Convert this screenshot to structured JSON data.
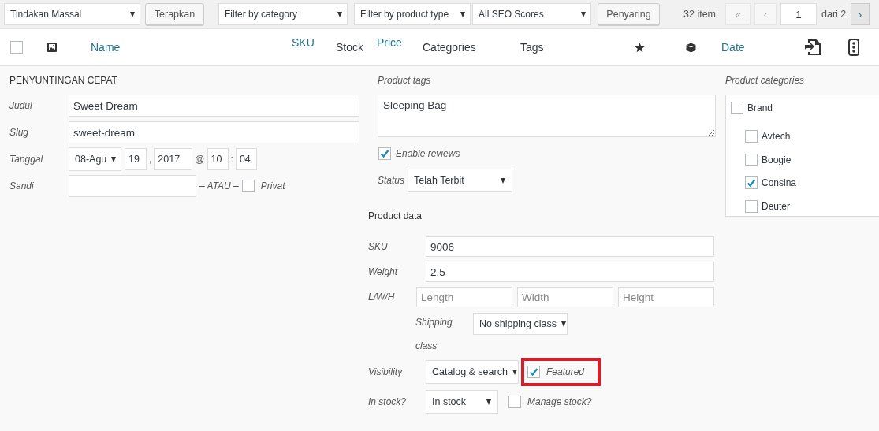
{
  "toolbar": {
    "bulk_action": "Tindakan Massal",
    "apply_button": "Terapkan",
    "filters": [
      {
        "value": "Filter by category"
      },
      {
        "value": "Filter by product type"
      },
      {
        "value": "All SEO Scores"
      }
    ],
    "filter_button": "Penyaring",
    "item_count": "32 item",
    "pagination": {
      "first": "«",
      "previous": "‹",
      "page": "1",
      "of": "dari 2",
      "next": "›"
    }
  },
  "table": {
    "columns": [
      {
        "kind": "checkbox",
        "checked": false
      },
      {
        "kind": "image"
      },
      {
        "kind": "link",
        "label": "Name"
      },
      {
        "kind": "sortable",
        "label": "SKU"
      },
      {
        "kind": "plain",
        "label": "Stock"
      },
      {
        "kind": "sortable",
        "label": "Price"
      },
      {
        "kind": "plain",
        "label": "Categories"
      },
      {
        "kind": "plain",
        "label": "Tags"
      },
      {
        "kind": "star"
      },
      {
        "kind": "cube"
      },
      {
        "kind": "link",
        "label": "Date"
      },
      {
        "kind": "import"
      },
      {
        "kind": "lights"
      }
    ]
  },
  "quick_edit": {
    "heading": "PENYUNTINGAN CEPAT",
    "fields": [
      {
        "label": "Judul",
        "value": "Sweet Dream"
      },
      {
        "label": "Slug",
        "value": "sweet-dream"
      }
    ],
    "date": {
      "label": "Tanggal",
      "month": "08-Agu",
      "day": "19",
      "comma": ",",
      "year": "2017",
      "at": "@",
      "hour": "10",
      "colon": ":",
      "minute": "04"
    },
    "password": {
      "label": "Sandi",
      "or": "– ATAU –",
      "private_label": "Privat",
      "private_checked": false
    },
    "tags": {
      "label": "Product tags",
      "value": "Sleeping Bag"
    },
    "enable_reviews": {
      "label": "Enable reviews",
      "checked": true
    },
    "status": {
      "label": "Status",
      "value": "Telah Terbit"
    },
    "product_data": {
      "heading": "Product data",
      "sku": {
        "label": "SKU",
        "value": "9006"
      },
      "weight": {
        "label": "Weight",
        "value": "2.5"
      },
      "dimensions": {
        "label": "L/W/H",
        "fields": [
          {
            "placeholder": "Length"
          },
          {
            "placeholder": "Width"
          },
          {
            "placeholder": "Height"
          }
        ]
      },
      "shipping_class": {
        "label": "Shipping class",
        "value": "No shipping class"
      },
      "visibility": {
        "label": "Visibility",
        "value": "Catalog & search"
      },
      "featured": {
        "label": "Featured",
        "checked": true,
        "highlighted": true
      },
      "stock": {
        "label": "In stock?",
        "value": "In stock"
      },
      "manage_stock": {
        "label": "Manage stock?",
        "checked": false
      }
    },
    "categories": {
      "label": "Product categories",
      "items": [
        {
          "label": "Brand",
          "checked": false,
          "children": [
            {
              "label": "Avtech",
              "checked": false
            },
            {
              "label": "Boogie",
              "checked": false
            },
            {
              "label": "Consina",
              "checked": true
            },
            {
              "label": "Deuter",
              "checked": false
            }
          ]
        }
      ]
    }
  }
}
